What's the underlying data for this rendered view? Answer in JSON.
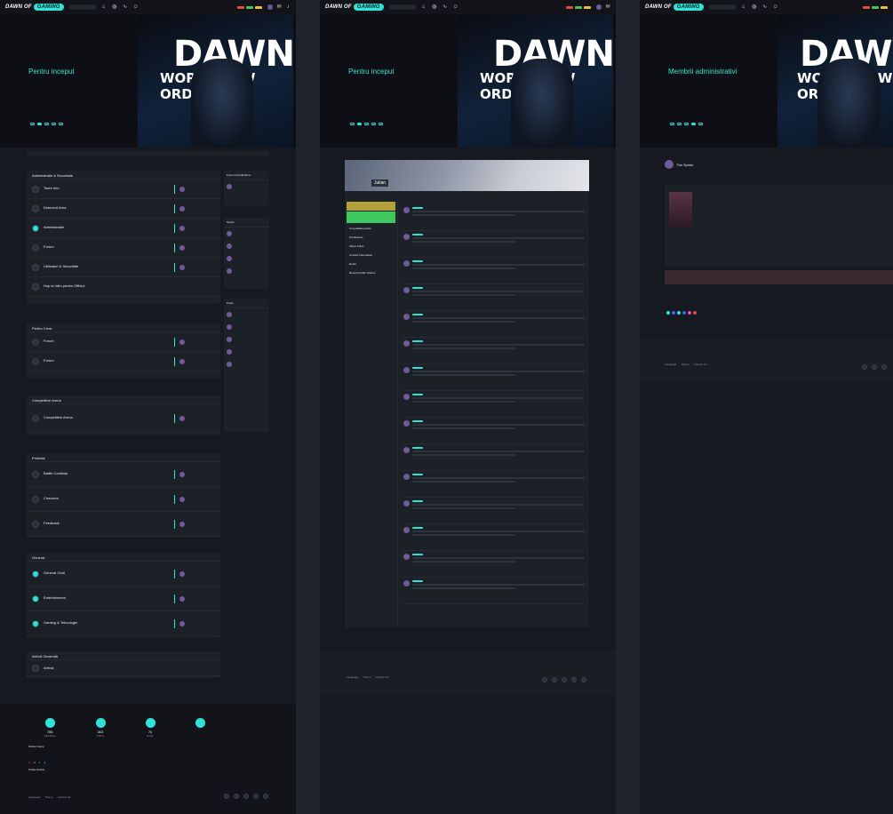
{
  "brand": {
    "logo_text": "DAWN OF",
    "logo_badge": "GAMING"
  },
  "hero": {
    "art_title": "DAWN",
    "art_subtitle": "WORLD NEW ORDER",
    "panel1_title": "Pentru inceput",
    "panel2_title": "Pentru inceput",
    "panel3_title": "Membrii administrativi"
  },
  "forum_sections": [
    {
      "title": "Administratie & Securitate",
      "rows": [
        "Team Info",
        "Diamond Area",
        "Administratie",
        "Forum",
        "Utilizatori & Securitate",
        "Hop la Intru pentru Officiul"
      ]
    },
    {
      "title": "Pentru Ceva",
      "rows": [
        "Forum",
        "Forum"
      ]
    },
    {
      "title": "Competitive Arena",
      "rows": [
        "Competitive Arena"
      ]
    },
    {
      "title": "Protests",
      "rows": [
        "Battle Contests",
        "Checkers",
        "Feedback"
      ]
    },
    {
      "title": "General",
      "rows": [
        "General Chat",
        "Entertainment",
        "Gaming & Tehnologie"
      ]
    },
    {
      "title": "Arhivă Generală",
      "rows": [
        "Arhivă"
      ]
    }
  ],
  "side_sections": [
    "Forum Contributions",
    "Topics",
    "Posts"
  ],
  "stats": [
    {
      "num": "786",
      "label": "Members"
    },
    {
      "num": "303",
      "label": "Online"
    },
    {
      "num": "7k",
      "label": "Posts"
    },
    {
      "num": "",
      "label": ""
    }
  ],
  "online_label": "Online Users",
  "today_label": "Today Activity",
  "footer_links": [
    "Language",
    "Theme",
    "Contact Us"
  ],
  "profile": {
    "name": "Julian",
    "follow_label": "Follow",
    "badge_label": "Registered Member",
    "rank_label": "0 reputation points",
    "followers_label": "0 Followers",
    "about_label": "About Julian",
    "contact_label": "Contact Information",
    "email_label": "Email",
    "visitors_label": "Recent Profile Visitors"
  },
  "admin": {
    "name": "The Spinto"
  },
  "colors": {
    "accent": "#2fe3d9",
    "bg": "#16191f",
    "card": "#1c2027"
  }
}
